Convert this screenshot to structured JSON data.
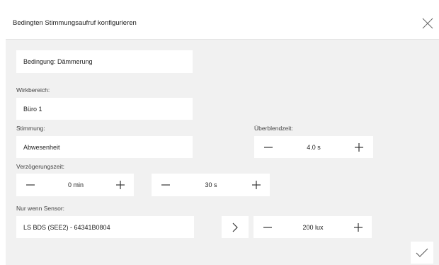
{
  "dialog": {
    "title": "Bedingten Stimmungsaufruf konfigurieren"
  },
  "condition": {
    "value": "Bedingung: Dämmerung"
  },
  "wirkbereich": {
    "label": "Wirkbereich:",
    "value": "Büro 1"
  },
  "stimmung": {
    "label": "Stimmung:",
    "value": "Abwesenheit"
  },
  "ueberblendzeit": {
    "label": "Überblendzeit:",
    "value": "4.0 s"
  },
  "verzoegerungszeit": {
    "label": "Verzögerungszeit:",
    "minutes": "0 min",
    "seconds": "30 s"
  },
  "sensor": {
    "label": "Nur wenn Sensor:",
    "value": "LS BDS (SEE2) - 64341B0804",
    "threshold": "200 lux"
  },
  "icons": {
    "close": "close-icon",
    "minus": "minus-icon",
    "plus": "plus-icon",
    "chevron": "chevron-right-icon",
    "confirm": "checkmark-icon"
  }
}
